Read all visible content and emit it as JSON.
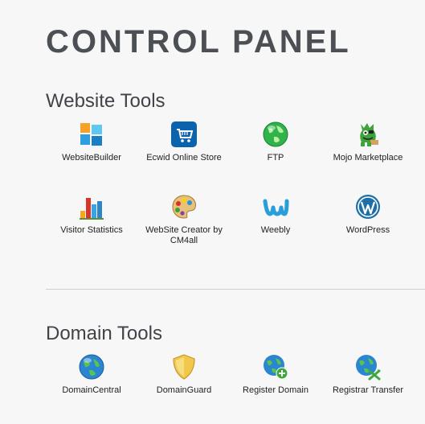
{
  "page": {
    "title": "CONTROL PANEL"
  },
  "website_tools": {
    "heading": "Website Tools",
    "items": [
      {
        "label": "WebsiteBuilder",
        "icon": "website-builder-icon"
      },
      {
        "label": "Ecwid Online Store",
        "icon": "shopping-cart-icon"
      },
      {
        "label": "FTP",
        "icon": "globe-icon"
      },
      {
        "label": "Mojo Marketplace",
        "icon": "monster-icon"
      },
      {
        "label": "Visitor Statistics",
        "icon": "bar-chart-icon"
      },
      {
        "label": "WebSite Creator by CM4all",
        "icon": "palette-icon"
      },
      {
        "label": "Weebly",
        "icon": "weebly-icon"
      },
      {
        "label": "WordPress",
        "icon": "wordpress-icon"
      }
    ]
  },
  "domain_tools": {
    "heading": "Domain Tools",
    "items": [
      {
        "label": "DomainCentral",
        "icon": "globe-icon"
      },
      {
        "label": "DomainGuard",
        "icon": "shield-icon"
      },
      {
        "label": "Register Domain",
        "icon": "globe-plus-icon"
      },
      {
        "label": "Registrar Transfer",
        "icon": "globe-transfer-icon"
      }
    ]
  }
}
